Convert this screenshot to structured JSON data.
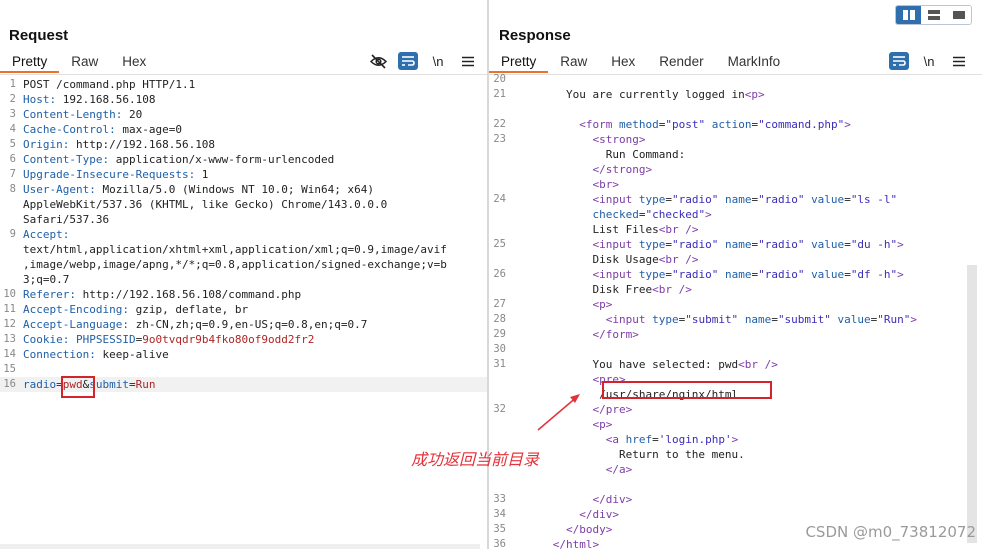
{
  "request": {
    "title": "Request",
    "tabs": [
      "Pretty",
      "Raw",
      "Hex"
    ],
    "tools": {
      "newline": "\\n"
    },
    "lines": [
      {
        "n": "1",
        "parts": [
          {
            "c": "tx",
            "t": "POST /command.php HTTP/1.1"
          }
        ]
      },
      {
        "n": "2",
        "parts": [
          {
            "c": "k",
            "t": "Host:"
          },
          {
            "c": "tx",
            "t": " 192.168.56.108"
          }
        ]
      },
      {
        "n": "3",
        "parts": [
          {
            "c": "k",
            "t": "Content-Length:"
          },
          {
            "c": "tx",
            "t": " 20"
          }
        ]
      },
      {
        "n": "4",
        "parts": [
          {
            "c": "k",
            "t": "Cache-Control:"
          },
          {
            "c": "tx",
            "t": " max-age=0"
          }
        ]
      },
      {
        "n": "5",
        "parts": [
          {
            "c": "k",
            "t": "Origin:"
          },
          {
            "c": "tx",
            "t": " http://192.168.56.108"
          }
        ]
      },
      {
        "n": "6",
        "parts": [
          {
            "c": "k",
            "t": "Content-Type:"
          },
          {
            "c": "tx",
            "t": " application/x-www-form-urlencoded"
          }
        ]
      },
      {
        "n": "7",
        "parts": [
          {
            "c": "k",
            "t": "Upgrade-Insecure-Requests:"
          },
          {
            "c": "tx",
            "t": " 1"
          }
        ]
      },
      {
        "n": "8",
        "parts": [
          {
            "c": "k",
            "t": "User-Agent:"
          },
          {
            "c": "tx",
            "t": " Mozilla/5.0 (Windows NT 10.0; Win64; x64)"
          }
        ]
      },
      {
        "n": "",
        "parts": [
          {
            "c": "tx",
            "t": "AppleWebKit/537.36 (KHTML, like Gecko) Chrome/143.0.0.0"
          }
        ]
      },
      {
        "n": "",
        "parts": [
          {
            "c": "tx",
            "t": "Safari/537.36"
          }
        ]
      },
      {
        "n": "9",
        "parts": [
          {
            "c": "k",
            "t": "Accept:"
          }
        ]
      },
      {
        "n": "",
        "parts": [
          {
            "c": "tx",
            "t": "text/html,application/xhtml+xml,application/xml;q=0.9,image/avif"
          }
        ]
      },
      {
        "n": "",
        "parts": [
          {
            "c": "tx",
            "t": ",image/webp,image/apng,*/*;q=0.8,application/signed-exchange;v=b"
          }
        ]
      },
      {
        "n": "",
        "parts": [
          {
            "c": "tx",
            "t": "3;q=0.7"
          }
        ]
      },
      {
        "n": "10",
        "parts": [
          {
            "c": "k",
            "t": "Referer:"
          },
          {
            "c": "tx",
            "t": " http://192.168.56.108/command.php"
          }
        ]
      },
      {
        "n": "11",
        "parts": [
          {
            "c": "k",
            "t": "Accept-Encoding:"
          },
          {
            "c": "tx",
            "t": " gzip, deflate, br"
          }
        ]
      },
      {
        "n": "12",
        "parts": [
          {
            "c": "k",
            "t": "Accept-Language:"
          },
          {
            "c": "tx",
            "t": " zh-CN,zh;q=0.9,en-US;q=0.8,en;q=0.7"
          }
        ]
      },
      {
        "n": "13",
        "parts": [
          {
            "c": "k",
            "t": "Cookie:"
          },
          {
            "c": "tx",
            "t": " "
          },
          {
            "c": "k",
            "t": "PHPSESSID"
          },
          {
            "c": "tx",
            "t": "="
          },
          {
            "c": "v",
            "t": "9o0tvqdr9b4fko80of9odd2fr2"
          }
        ]
      },
      {
        "n": "14",
        "parts": [
          {
            "c": "k",
            "t": "Connection:"
          },
          {
            "c": "tx",
            "t": " keep-alive"
          }
        ]
      },
      {
        "n": "15",
        "parts": []
      },
      {
        "n": "16",
        "hl": true,
        "parts": [
          {
            "c": "k",
            "t": "radio"
          },
          {
            "c": "tx",
            "t": "="
          },
          {
            "c": "v",
            "t": "pwd"
          },
          {
            "c": "tx",
            "t": "&"
          },
          {
            "c": "k",
            "t": "submit"
          },
          {
            "c": "tx",
            "t": "="
          },
          {
            "c": "v",
            "t": "Run"
          }
        ]
      }
    ]
  },
  "response": {
    "title": "Response",
    "tabs": [
      "Pretty",
      "Raw",
      "Hex",
      "Render",
      "MarkInfo"
    ],
    "tools": {
      "newline": "\\n"
    },
    "lines": [
      {
        "n": "20",
        "parts": []
      },
      {
        "n": "21",
        "parts": [
          {
            "c": "tx",
            "t": "        You are currently logged in"
          },
          {
            "c": "t",
            "t": "<p>"
          }
        ]
      },
      {
        "n": "",
        "parts": []
      },
      {
        "n": "22",
        "parts": [
          {
            "c": "t",
            "t": "          <form "
          },
          {
            "c": "an",
            "t": "method"
          },
          {
            "c": "tx",
            "t": "="
          },
          {
            "c": "av",
            "t": "\"post\""
          },
          {
            "c": "tx",
            "t": " "
          },
          {
            "c": "an",
            "t": "action"
          },
          {
            "c": "tx",
            "t": "="
          },
          {
            "c": "av",
            "t": "\"command.php\""
          },
          {
            "c": "t",
            "t": ">"
          }
        ]
      },
      {
        "n": "23",
        "parts": [
          {
            "c": "t",
            "t": "            <strong>"
          }
        ]
      },
      {
        "n": "",
        "parts": [
          {
            "c": "tx",
            "t": "              Run Command:"
          }
        ]
      },
      {
        "n": "",
        "parts": [
          {
            "c": "t",
            "t": "            </strong>"
          }
        ]
      },
      {
        "n": "",
        "parts": [
          {
            "c": "t",
            "t": "            <br>"
          }
        ]
      },
      {
        "n": "24",
        "parts": [
          {
            "c": "t",
            "t": "            <input "
          },
          {
            "c": "an",
            "t": "type"
          },
          {
            "c": "tx",
            "t": "="
          },
          {
            "c": "av",
            "t": "\"radio\""
          },
          {
            "c": "tx",
            "t": " "
          },
          {
            "c": "an",
            "t": "name"
          },
          {
            "c": "tx",
            "t": "="
          },
          {
            "c": "av",
            "t": "\"radio\""
          },
          {
            "c": "tx",
            "t": " "
          },
          {
            "c": "an",
            "t": "value"
          },
          {
            "c": "tx",
            "t": "="
          },
          {
            "c": "av",
            "t": "\"ls -l\""
          }
        ]
      },
      {
        "n": "",
        "parts": [
          {
            "c": "tx",
            "t": "            "
          },
          {
            "c": "an",
            "t": "checked"
          },
          {
            "c": "tx",
            "t": "="
          },
          {
            "c": "av",
            "t": "\"checked\""
          },
          {
            "c": "t",
            "t": ">"
          }
        ]
      },
      {
        "n": "",
        "parts": [
          {
            "c": "tx",
            "t": "            List Files"
          },
          {
            "c": "t",
            "t": "<br />"
          }
        ]
      },
      {
        "n": "25",
        "parts": [
          {
            "c": "t",
            "t": "            <input "
          },
          {
            "c": "an",
            "t": "type"
          },
          {
            "c": "tx",
            "t": "="
          },
          {
            "c": "av",
            "t": "\"radio\""
          },
          {
            "c": "tx",
            "t": " "
          },
          {
            "c": "an",
            "t": "name"
          },
          {
            "c": "tx",
            "t": "="
          },
          {
            "c": "av",
            "t": "\"radio\""
          },
          {
            "c": "tx",
            "t": " "
          },
          {
            "c": "an",
            "t": "value"
          },
          {
            "c": "tx",
            "t": "="
          },
          {
            "c": "av",
            "t": "\"du -h\""
          },
          {
            "c": "t",
            "t": ">"
          }
        ]
      },
      {
        "n": "",
        "parts": [
          {
            "c": "tx",
            "t": "            Disk Usage"
          },
          {
            "c": "t",
            "t": "<br />"
          }
        ]
      },
      {
        "n": "26",
        "parts": [
          {
            "c": "t",
            "t": "            <input "
          },
          {
            "c": "an",
            "t": "type"
          },
          {
            "c": "tx",
            "t": "="
          },
          {
            "c": "av",
            "t": "\"radio\""
          },
          {
            "c": "tx",
            "t": " "
          },
          {
            "c": "an",
            "t": "name"
          },
          {
            "c": "tx",
            "t": "="
          },
          {
            "c": "av",
            "t": "\"radio\""
          },
          {
            "c": "tx",
            "t": " "
          },
          {
            "c": "an",
            "t": "value"
          },
          {
            "c": "tx",
            "t": "="
          },
          {
            "c": "av",
            "t": "\"df -h\""
          },
          {
            "c": "t",
            "t": ">"
          }
        ]
      },
      {
        "n": "",
        "parts": [
          {
            "c": "tx",
            "t": "            Disk Free"
          },
          {
            "c": "t",
            "t": "<br />"
          }
        ]
      },
      {
        "n": "27",
        "parts": [
          {
            "c": "t",
            "t": "            <p>"
          }
        ]
      },
      {
        "n": "28",
        "parts": [
          {
            "c": "t",
            "t": "              <input "
          },
          {
            "c": "an",
            "t": "type"
          },
          {
            "c": "tx",
            "t": "="
          },
          {
            "c": "av",
            "t": "\"submit\""
          },
          {
            "c": "tx",
            "t": " "
          },
          {
            "c": "an",
            "t": "name"
          },
          {
            "c": "tx",
            "t": "="
          },
          {
            "c": "av",
            "t": "\"submit\""
          },
          {
            "c": "tx",
            "t": " "
          },
          {
            "c": "an",
            "t": "value"
          },
          {
            "c": "tx",
            "t": "="
          },
          {
            "c": "av",
            "t": "\"Run\""
          },
          {
            "c": "t",
            "t": ">"
          }
        ]
      },
      {
        "n": "29",
        "parts": [
          {
            "c": "t",
            "t": "            </form>"
          }
        ]
      },
      {
        "n": "30",
        "parts": []
      },
      {
        "n": "31",
        "parts": [
          {
            "c": "tx",
            "t": "            You have selected: pwd"
          },
          {
            "c": "t",
            "t": "<br />"
          }
        ]
      },
      {
        "n": "",
        "parts": [
          {
            "c": "t",
            "t": "            <pre>"
          }
        ]
      },
      {
        "n": "",
        "parts": [
          {
            "c": "tx",
            "t": "             /usr/share/nginx/html"
          }
        ]
      },
      {
        "n": "32",
        "parts": [
          {
            "c": "t",
            "t": "            </pre>"
          }
        ]
      },
      {
        "n": "",
        "parts": [
          {
            "c": "t",
            "t": "            <p>"
          }
        ]
      },
      {
        "n": "",
        "parts": [
          {
            "c": "t",
            "t": "              <a "
          },
          {
            "c": "an",
            "t": "href"
          },
          {
            "c": "tx",
            "t": "="
          },
          {
            "c": "av",
            "t": "'login.php'"
          },
          {
            "c": "t",
            "t": ">"
          }
        ]
      },
      {
        "n": "",
        "parts": [
          {
            "c": "tx",
            "t": "                Return to the menu."
          }
        ]
      },
      {
        "n": "",
        "parts": [
          {
            "c": "t",
            "t": "              </a>"
          }
        ]
      },
      {
        "n": "",
        "parts": []
      },
      {
        "n": "33",
        "parts": [
          {
            "c": "t",
            "t": "            </div>"
          }
        ]
      },
      {
        "n": "34",
        "parts": [
          {
            "c": "t",
            "t": "          </div>"
          }
        ]
      },
      {
        "n": "35",
        "parts": [
          {
            "c": "t",
            "t": "        </body>"
          }
        ]
      },
      {
        "n": "36",
        "parts": [
          {
            "c": "t",
            "t": "      </html>"
          }
        ]
      }
    ]
  },
  "annotation": {
    "text": "成功返回当前目录"
  },
  "watermark": "CSDN @m0_73812072",
  "colors": {
    "accent_orange": "#e8742c",
    "tool_blue": "#2f6fae",
    "annotation_red": "#d4232b"
  }
}
